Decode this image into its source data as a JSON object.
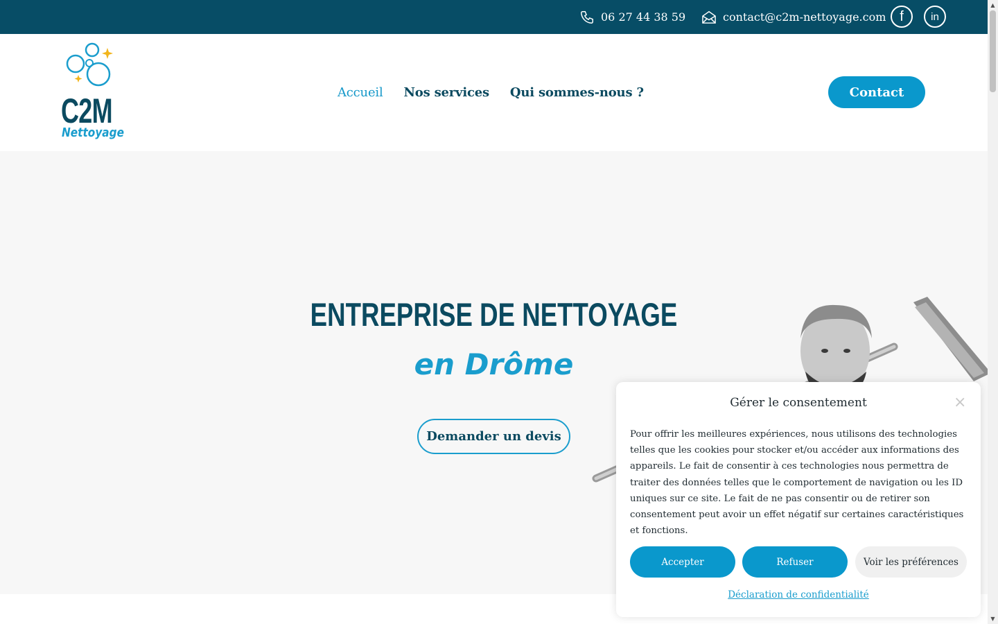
{
  "topbar": {
    "phone": "06 27 44 38 59",
    "email": "contact@c2m-nettoyage.com",
    "social": [
      {
        "name": "facebook",
        "glyph": "f"
      },
      {
        "name": "linkedin",
        "glyph": "in"
      }
    ],
    "bg_color": "#074d66"
  },
  "header": {
    "logo": {
      "main": "C2M",
      "sub": "Nettoyage"
    },
    "nav": [
      {
        "label": "Accueil",
        "active": true
      },
      {
        "label": "Nos services",
        "active": false
      },
      {
        "label": "Qui sommes-nous ?",
        "active": false
      }
    ],
    "contact_label": "Contact"
  },
  "hero": {
    "title": "ENTREPRISE DE NETTOYAGE",
    "subtitle": "en Drôme",
    "cta_label": "Demander un devis"
  },
  "cookie": {
    "title": "Gérer le consentement",
    "close": "×",
    "body": "Pour offrir les meilleures expériences, nous utilisons des technologies telles que les cookies pour stocker et/ou accéder aux informations des appareils. Le fait de consentir à ces technologies nous permettra de traiter des données telles que le comportement de navigation ou les ID uniques sur ce site. Le fait de ne pas consentir ou de retirer son consentement peut avoir un effet négatif sur certaines caractéristiques et fonctions.",
    "accept_label": "Accepter",
    "refuse_label": "Refuser",
    "prefs_label": "Voir les préférences",
    "privacy_label": "Déclaration de confidentialité"
  },
  "colors": {
    "primary": "#0a98cc",
    "dark": "#0b4a60",
    "hero_bg": "#f7f7f7"
  }
}
